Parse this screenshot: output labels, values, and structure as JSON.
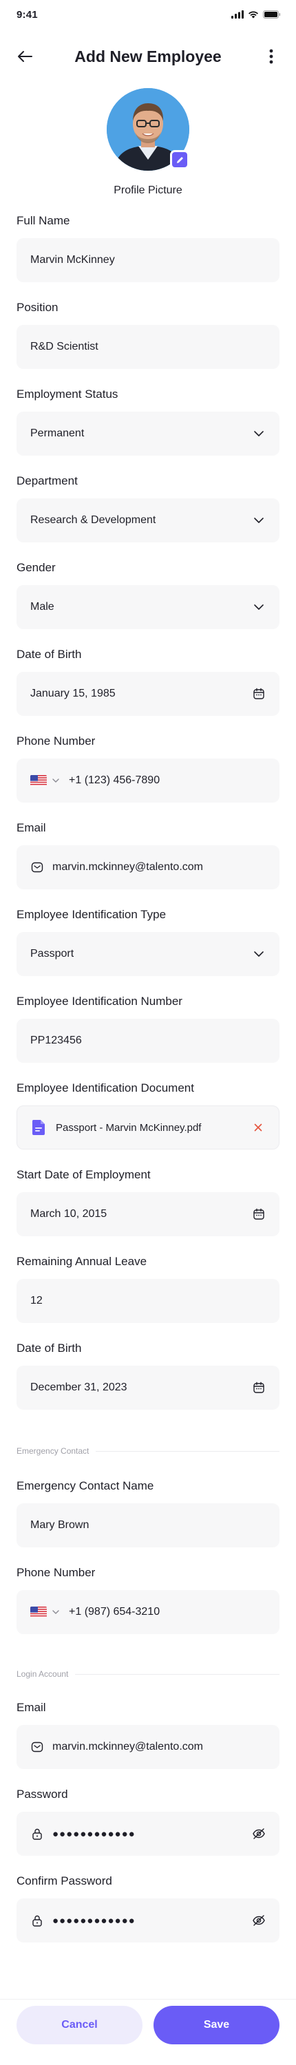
{
  "status_bar": {
    "time": "9:41"
  },
  "header": {
    "title": "Add New Employee"
  },
  "avatar": {
    "label": "Profile Picture"
  },
  "fields": {
    "full_name": {
      "label": "Full Name",
      "value": "Marvin McKinney"
    },
    "position": {
      "label": "Position",
      "value": "R&D Scientist"
    },
    "employment_status": {
      "label": "Employment Status",
      "value": "Permanent"
    },
    "department": {
      "label": "Department",
      "value": "Research & Development"
    },
    "gender": {
      "label": "Gender",
      "value": "Male"
    },
    "date_of_birth": {
      "label": "Date of Birth",
      "value": "January 15, 1985"
    },
    "phone_number": {
      "label": "Phone Number",
      "value": "+1 (123) 456-7890"
    },
    "email": {
      "label": "Email",
      "value": "marvin.mckinney@talento.com"
    },
    "id_type": {
      "label": "Employee Identification Type",
      "value": "Passport"
    },
    "id_number": {
      "label": "Employee Identification Number",
      "value": "PP123456"
    },
    "id_document": {
      "label": "Employee Identification Document",
      "value": "Passport - Marvin McKinney.pdf"
    },
    "start_date": {
      "label": "Start Date of Employment",
      "value": "March 10, 2015"
    },
    "remaining_leave": {
      "label": "Remaining Annual Leave",
      "value": "12"
    },
    "date_of_birth_2": {
      "label": "Date of Birth",
      "value": "December 31, 2023"
    }
  },
  "emergency": {
    "section_label": "Emergency Contact",
    "name": {
      "label": "Emergency Contact Name",
      "value": "Mary Brown"
    },
    "phone": {
      "label": "Phone Number",
      "value": "+1 (987) 654-3210"
    }
  },
  "login": {
    "section_label": "Login Account",
    "email": {
      "label": "Email",
      "value": "marvin.mckinney@talento.com"
    },
    "password": {
      "label": "Password",
      "value": "●●●●●●●●●●●●"
    },
    "confirm_password": {
      "label": "Confirm Password",
      "value": "●●●●●●●●●●●●"
    }
  },
  "actions": {
    "cancel_label": "Cancel",
    "save_label": "Save"
  },
  "colors": {
    "accent": "#6a5cf6",
    "accent_soft": "#eeecfc",
    "input_bg": "#f7f7f8",
    "remove": "#e5533d"
  }
}
